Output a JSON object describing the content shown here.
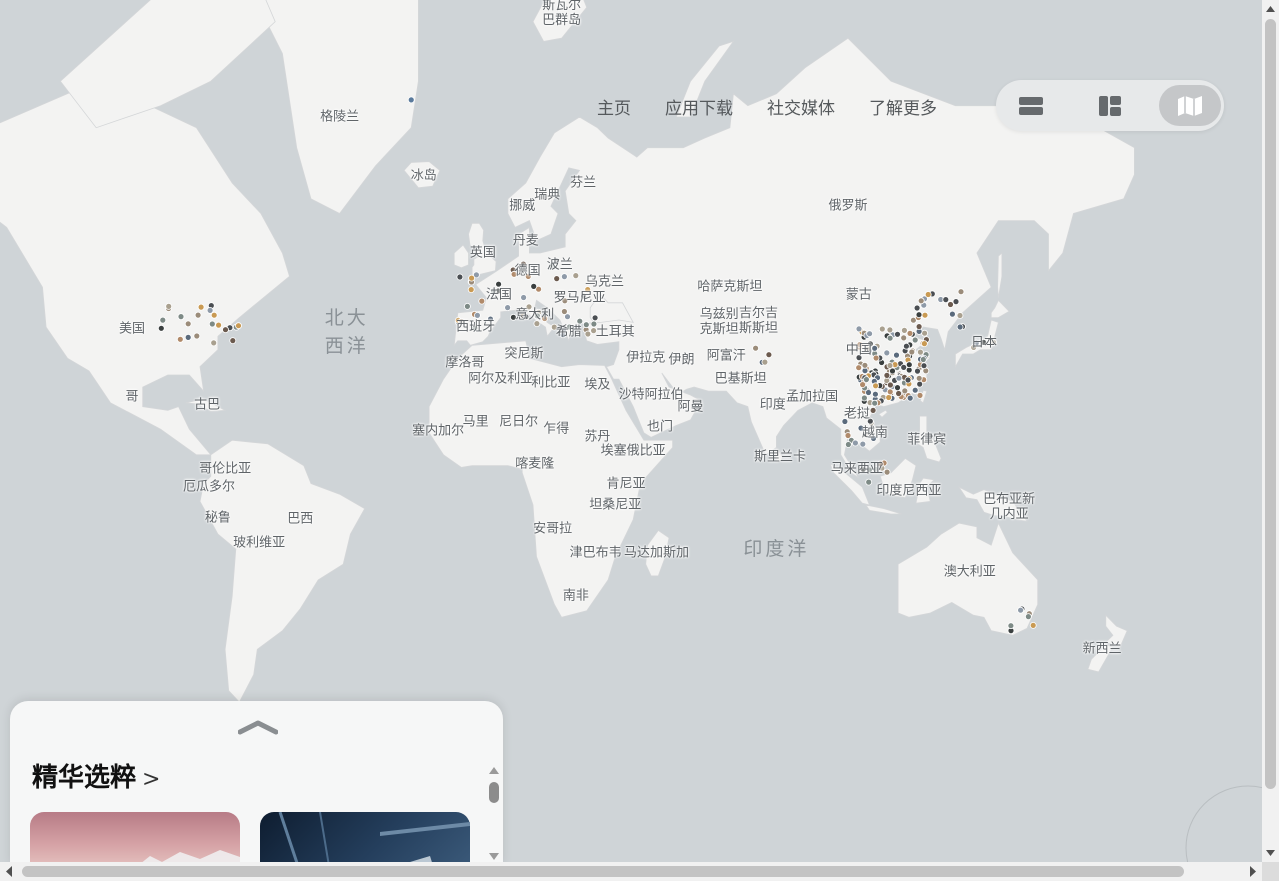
{
  "nav": {
    "items": [
      "主页",
      "应用下载",
      "社交媒体",
      "了解更多"
    ]
  },
  "view_toggle": {
    "options": [
      "list-view-icon",
      "grid-view-icon",
      "map-view-icon"
    ],
    "active": "map-view-icon"
  },
  "map": {
    "colors": {
      "water": "#cfd4d7",
      "land": "#f3f3f2",
      "border": "#d4d6d8"
    },
    "countries": [
      {
        "name": "斯瓦尔\n巴群岛",
        "lon": 20,
        "lat": 78.5
      },
      {
        "name": "格陵兰",
        "lon": -42,
        "lat": 71
      },
      {
        "name": "冰岛",
        "lon": -18.5,
        "lat": 64.8
      },
      {
        "name": "瑞典",
        "lon": 16,
        "lat": 62.5
      },
      {
        "name": "芬兰",
        "lon": 26,
        "lat": 64
      },
      {
        "name": "挪威",
        "lon": 9,
        "lat": 61
      },
      {
        "name": "俄罗斯",
        "lon": 100,
        "lat": 61
      },
      {
        "name": "丹麦",
        "lon": 10,
        "lat": 56
      },
      {
        "name": "英国",
        "lon": -2,
        "lat": 54
      },
      {
        "name": "波兰",
        "lon": 19.5,
        "lat": 52
      },
      {
        "name": "德国",
        "lon": 10.5,
        "lat": 51
      },
      {
        "name": "乌克兰",
        "lon": 32,
        "lat": 49
      },
      {
        "name": "法国",
        "lon": 2.5,
        "lat": 46.5
      },
      {
        "name": "罗马尼亚",
        "lon": 25,
        "lat": 46
      },
      {
        "name": "哈萨克斯坦",
        "lon": 67,
        "lat": 48
      },
      {
        "name": "蒙古",
        "lon": 103,
        "lat": 46.5
      },
      {
        "name": "意大利",
        "lon": 12.5,
        "lat": 42.5
      },
      {
        "name": "西班牙",
        "lon": -4,
        "lat": 40
      },
      {
        "name": "乌兹别\n克斯坦",
        "lon": 64,
        "lat": 41
      },
      {
        "name": "吉尔吉\n斯斯坦",
        "lon": 75,
        "lat": 41.3
      },
      {
        "name": "希腊",
        "lon": 22,
        "lat": 39
      },
      {
        "name": "土耳其",
        "lon": 35,
        "lat": 39
      },
      {
        "name": "日本",
        "lon": 138,
        "lat": 36.5
      },
      {
        "name": "中国",
        "lon": 103,
        "lat": 35
      },
      {
        "name": "突尼斯",
        "lon": 9.5,
        "lat": 34
      },
      {
        "name": "伊拉克",
        "lon": 43.5,
        "lat": 33
      },
      {
        "name": "伊朗",
        "lon": 53.5,
        "lat": 32.5
      },
      {
        "name": "阿富汗",
        "lon": 66,
        "lat": 33.5
      },
      {
        "name": "摩洛哥",
        "lon": -7,
        "lat": 32
      },
      {
        "name": "阿尔及利亚",
        "lon": 3,
        "lat": 28
      },
      {
        "name": "利比亚",
        "lon": 17,
        "lat": 27
      },
      {
        "name": "埃及",
        "lon": 30,
        "lat": 26.5
      },
      {
        "name": "巴基斯坦",
        "lon": 70,
        "lat": 28
      },
      {
        "name": "沙特阿拉伯",
        "lon": 45,
        "lat": 24
      },
      {
        "name": "孟加拉国",
        "lon": 90,
        "lat": 23.5
      },
      {
        "name": "印度",
        "lon": 79,
        "lat": 21.5
      },
      {
        "name": "阿曼",
        "lon": 56,
        "lat": 21
      },
      {
        "name": "古巴",
        "lon": -79,
        "lat": 21.5
      },
      {
        "name": "老挝",
        "lon": 102.5,
        "lat": 19
      },
      {
        "name": "塞内加尔",
        "lon": -14.5,
        "lat": 14.5
      },
      {
        "name": "马里",
        "lon": -4,
        "lat": 17
      },
      {
        "name": "尼日尔",
        "lon": 8,
        "lat": 17
      },
      {
        "name": "乍得",
        "lon": 18.5,
        "lat": 15
      },
      {
        "name": "苏丹",
        "lon": 30,
        "lat": 13
      },
      {
        "name": "也门",
        "lon": 47.5,
        "lat": 15.5
      },
      {
        "name": "越南",
        "lon": 107.5,
        "lat": 14
      },
      {
        "name": "菲律宾",
        "lon": 122,
        "lat": 12
      },
      {
        "name": "埃塞俄比亚",
        "lon": 40,
        "lat": 9
      },
      {
        "name": "斯里兰卡",
        "lon": 81,
        "lat": 7.5
      },
      {
        "name": "喀麦隆",
        "lon": 12.5,
        "lat": 5.5
      },
      {
        "name": "马来西亚",
        "lon": 102.5,
        "lat": 4
      },
      {
        "name": "哥伦比亚",
        "lon": -74,
        "lat": 4
      },
      {
        "name": "厄瓜多尔",
        "lon": -78.5,
        "lat": -1
      },
      {
        "name": "肯尼亚",
        "lon": 38,
        "lat": 0
      },
      {
        "name": "印度尼西亚",
        "lon": 117,
        "lat": -2
      },
      {
        "name": "巴布亚新\n几内亚",
        "lon": 145,
        "lat": -6.5
      },
      {
        "name": "坦桑尼亚",
        "lon": 35,
        "lat": -6
      },
      {
        "name": "秘鲁",
        "lon": -76,
        "lat": -9.5
      },
      {
        "name": "巴西",
        "lon": -53,
        "lat": -10
      },
      {
        "name": "安哥拉",
        "lon": 17.5,
        "lat": -12.5
      },
      {
        "name": "玻利维亚",
        "lon": -64.5,
        "lat": -16.5
      },
      {
        "name": "津巴布韦",
        "lon": 29.5,
        "lat": -19
      },
      {
        "name": "马达加斯加",
        "lon": 46.5,
        "lat": -19
      },
      {
        "name": "澳大利亚",
        "lon": 134,
        "lat": -24
      },
      {
        "name": "南非",
        "lon": 24,
        "lat": -30
      },
      {
        "name": "新西兰",
        "lon": 171,
        "lat": -42
      },
      {
        "name": "美国",
        "lon": -100,
        "lat": 39.5
      },
      {
        "name": "哥",
        "lon": -100,
        "lat": 23.5
      }
    ],
    "oceans": [
      {
        "name": "北大\n西洋",
        "lon": -40,
        "lat": 39
      },
      {
        "name": "印度洋",
        "lon": 80,
        "lat": -18
      }
    ],
    "photo_pins": {
      "note": "photo location markers clustered in China, Europe, US East Coast, SE Australia",
      "colors": [
        "#4a4e52",
        "#7d8a86",
        "#9b8c7a",
        "#5a6a7c",
        "#b08a6a",
        "#3a3f3f",
        "#8e9aa8",
        "#6b5a4e",
        "#a9a08f",
        "#c99a53"
      ]
    }
  },
  "panel": {
    "title": "精华选粹",
    "title_chevron": ">",
    "collapse_handle": "chevron-up-icon"
  }
}
